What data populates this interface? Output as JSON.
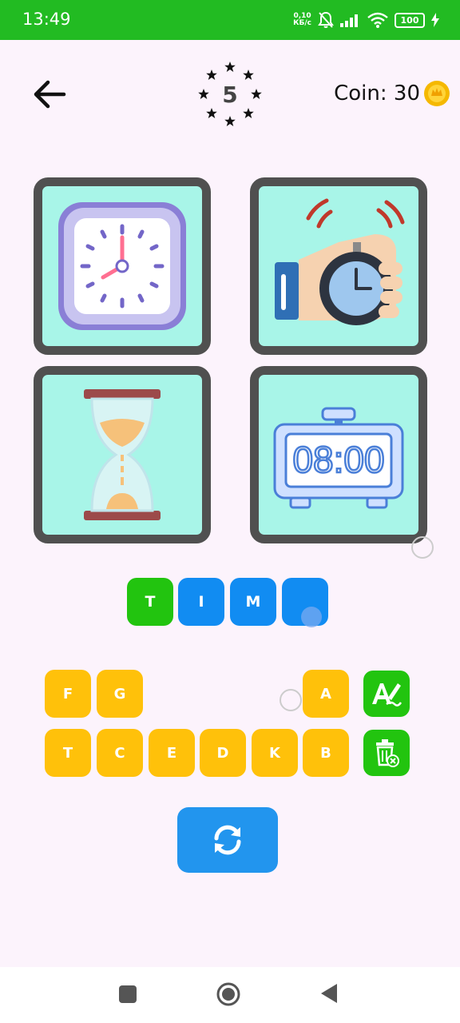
{
  "status_bar": {
    "time": "13:49",
    "net_speed_value": "0,10",
    "net_speed_unit": "КБ/с",
    "battery": "100"
  },
  "header": {
    "level": "5",
    "coin_label": "Coin: 30"
  },
  "images": [
    {
      "name": "wall-clock"
    },
    {
      "name": "stopwatch-in-hand"
    },
    {
      "name": "hourglass"
    },
    {
      "name": "digital-alarm-clock",
      "display": "08:00"
    }
  ],
  "answer_slots": [
    {
      "letter": "T",
      "state": "hint"
    },
    {
      "letter": "I",
      "state": "filled"
    },
    {
      "letter": "M",
      "state": "filled"
    },
    {
      "letter": "",
      "state": "empty"
    }
  ],
  "keyboard": {
    "row1": [
      "F",
      "G",
      "A"
    ],
    "row2": [
      "T",
      "C",
      "E",
      "D",
      "K",
      "B"
    ]
  },
  "colors": {
    "status_bar": "#22bb22",
    "background": "#fcf3fc",
    "card_border": "#505050",
    "card_bg": "#a8f5e8",
    "slot_hint": "#22c40f",
    "slot_filled": "#118cf2",
    "key": "#ffc10a",
    "action_green": "#22c40f",
    "refresh": "#2295ee"
  },
  "icons": {
    "back": "arrow-left-icon",
    "hint": "reveal-letter-icon",
    "remove": "trash-delete-icon",
    "refresh": "refresh-icon",
    "coin": "coin-icon"
  }
}
